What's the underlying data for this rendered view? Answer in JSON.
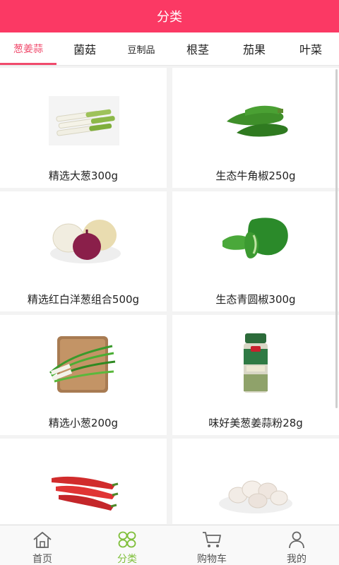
{
  "header": {
    "title": "分类"
  },
  "tabs": [
    {
      "label": "葱姜蒜",
      "active": true
    },
    {
      "label": "菌菇",
      "active": false
    },
    {
      "label": "豆制品",
      "active": false
    },
    {
      "label": "根茎",
      "active": false
    },
    {
      "label": "茄果",
      "active": false
    },
    {
      "label": "叶菜",
      "active": false
    }
  ],
  "products": [
    {
      "name": "精选大葱300g",
      "image": "leek-icon"
    },
    {
      "name": "生态牛角椒250g",
      "image": "green-horn-pepper-icon"
    },
    {
      "name": "精选红白洋葱组合500g",
      "image": "onion-icon"
    },
    {
      "name": "生态青圆椒300g",
      "image": "green-bell-pepper-icon"
    },
    {
      "name": "精选小葱200g",
      "image": "scallion-icon"
    },
    {
      "name": "味好美葱姜蒜粉28g",
      "image": "seasoning-jar-icon"
    },
    {
      "name": "",
      "image": "red-chili-icon"
    },
    {
      "name": "",
      "image": "garlic-icon"
    }
  ],
  "bottom_nav": [
    {
      "label": "首页",
      "icon": "home-icon",
      "active": false
    },
    {
      "label": "分类",
      "icon": "category-icon",
      "active": true
    },
    {
      "label": "购物车",
      "icon": "cart-icon",
      "active": false
    },
    {
      "label": "我的",
      "icon": "user-icon",
      "active": false
    }
  ],
  "colors": {
    "accent": "#fb3964",
    "tab_active": "#f04a6c",
    "nav_active": "#7fbf3a"
  }
}
